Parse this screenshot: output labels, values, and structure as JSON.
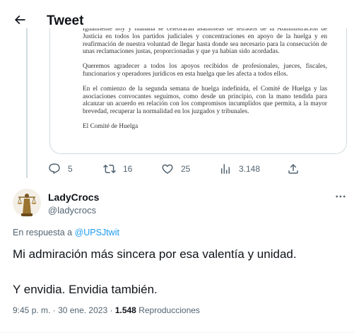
{
  "header": {
    "title": "Tweet"
  },
  "document": {
    "paragraphs": [
      "Igualmente hoy y mañana se celebrarán asambleas de letrados de la Administración de Justicia en todos los partidos judiciales y concentraciones en apoyo de la huelga y en reafirmación de nuestra voluntad de llegar hasta donde sea necesario para la consecución de unas reclamaciones justas, proporcionadas y que ya habían sido acordadas.",
      "Queremos agradecer a todos los apoyos recibidos de profesionales, jueces, fiscales, funcionarios y operadores jurídicos en esta huelga que les afecta a todos ellos.",
      "En el comienzo de la segunda semana de huelga indefinida, el Comité de Huelga y las asociaciones convocantes seguimos, como desde un principio, con la mano tendida para alcanzar un acuerdo en relación con los compromisos incumplidos que permita, a la mayor brevedad, recuperar la normalidad en los juzgados y tribunales.",
      "El Comité de Huelga"
    ]
  },
  "actions": {
    "replies": "5",
    "retweets": "16",
    "likes": "25",
    "views": "3.148"
  },
  "reply": {
    "author_name": "LadyCrocs",
    "author_handle": "@ladycrocs",
    "reply_prefix": "En respuesta a ",
    "reply_mention": "@UPSJtwit",
    "text_line1": "Mi admiración más sincera por esa valentía y unidad.",
    "text_line2": "Y envidia. Envidia también.",
    "time": "9:45 p. m.",
    "separator": "·",
    "date": "30 ene. 2023",
    "views_count": "1.548",
    "views_label": "Reproducciones"
  },
  "colors": {
    "text_primary": "#0f1419",
    "text_secondary": "#536471",
    "accent": "#1d9bf0",
    "border": "#cfd9de"
  },
  "icons": [
    "back-arrow-icon",
    "reply-icon",
    "retweet-icon",
    "like-icon",
    "views-icon",
    "share-icon",
    "more-icon"
  ]
}
